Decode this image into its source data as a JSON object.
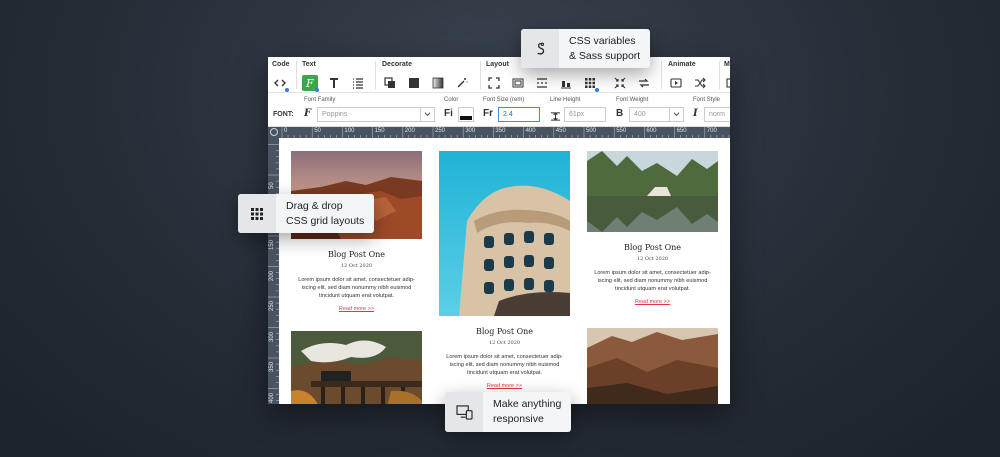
{
  "toolbar": {
    "groups": [
      {
        "label": "Code"
      },
      {
        "label": "Text"
      },
      {
        "label": "Decorate"
      },
      {
        "label": "Layout"
      },
      {
        "label": "Animate"
      },
      {
        "label": "M"
      }
    ]
  },
  "fontbar": {
    "prefix": "FONT:",
    "family_label": "Font Family",
    "family_value": "Poppins",
    "color_label": "Color",
    "size_label": "Font Size (rem)",
    "size_value": "2.4",
    "lineheight_label": "Line Height",
    "lineheight_value": "61px",
    "weight_label": "Font Weight",
    "weight_value": "400",
    "style_label": "Font Style",
    "style_value": "norm"
  },
  "ruler": {
    "top": [
      "0",
      "50",
      "100",
      "150",
      "200",
      "250",
      "300",
      "350",
      "400",
      "450",
      "500",
      "550",
      "600",
      "650",
      "700"
    ],
    "left": [
      "50",
      "100",
      "150",
      "200",
      "250",
      "300",
      "350",
      "400"
    ]
  },
  "posts": [
    {
      "title": "Blog Post One",
      "date": "12 Oct 2020",
      "body": "Lorem ipsum dolor sit amet, consectetuer adip-iscing elit, sed diam nonummy nibh euismod tincidunt utquam erat volutpat.",
      "link": "Read more >>"
    },
    {
      "title": "Blog Post One",
      "date": "12 Oct 2020",
      "body": "Lorem ipsum dolor sit amet, consectetuer adip-iscing elit, sed diam nonummy nibh euismod tincidunt utquam erat volutpat.",
      "link": "Read more >>"
    },
    {
      "title": "Blog Post One",
      "date": "12 Oct 2020",
      "body": "Lorem ipsum dolor sit amet, consectetuer adip-iscing elit, sed diam nonummy nibh euismod tincidunt utquam erat volutpat.",
      "link": "Read more >>"
    }
  ],
  "badges": {
    "css": {
      "line1": "CSS variables",
      "line2": "& Sass support",
      "icon": "css-variables-icon"
    },
    "grid": {
      "line1": "Drag & drop",
      "line2": "CSS grid layouts",
      "icon": "grid-icon"
    },
    "responsive": {
      "line1": "Make anything",
      "line2": "responsive",
      "icon": "devices-icon"
    }
  },
  "colors": {
    "accent_green": "#3fa54a",
    "link_red": "#e0364c",
    "ruler": "#4a5361",
    "input_blue": "#3a8ee6"
  }
}
